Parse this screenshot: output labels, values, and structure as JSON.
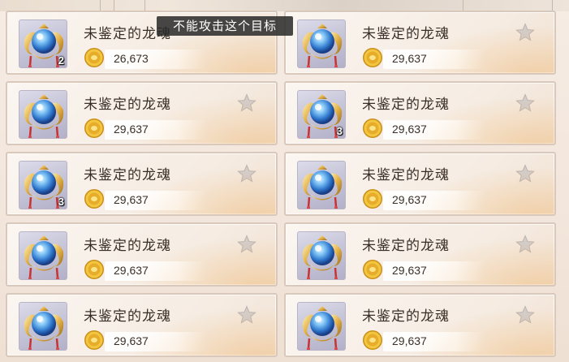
{
  "tooltip": "不能攻击这个目标",
  "item_name": "未鉴定的龙魂",
  "cards": [
    {
      "name": "未鉴定的龙魂",
      "price": "26,673",
      "stack": "2",
      "star": false
    },
    {
      "name": "未鉴定的龙魂",
      "price": "29,637",
      "stack": "",
      "star": true
    },
    {
      "name": "未鉴定的龙魂",
      "price": "29,637",
      "stack": "",
      "star": true
    },
    {
      "name": "未鉴定的龙魂",
      "price": "29,637",
      "stack": "3",
      "star": true
    },
    {
      "name": "未鉴定的龙魂",
      "price": "29,637",
      "stack": "3",
      "star": true
    },
    {
      "name": "未鉴定的龙魂",
      "price": "29,637",
      "stack": "",
      "star": true
    },
    {
      "name": "未鉴定的龙魂",
      "price": "29,637",
      "stack": "",
      "star": true
    },
    {
      "name": "未鉴定的龙魂",
      "price": "29,637",
      "stack": "",
      "star": true
    },
    {
      "name": "未鉴定的龙魂",
      "price": "29,637",
      "stack": "",
      "star": true
    },
    {
      "name": "未鉴定的龙魂",
      "price": "29,637",
      "stack": "",
      "star": true
    }
  ],
  "icons": {
    "item": "dragon-soul-orb-icon",
    "currency": "gold-coin-icon",
    "favorite": "star-icon"
  },
  "colors": {
    "card_border": "#d9c9bd",
    "text": "#3a2f28",
    "star": "#c9c2c0",
    "coin": "#e0b234",
    "orb": "#3f8fe0"
  }
}
